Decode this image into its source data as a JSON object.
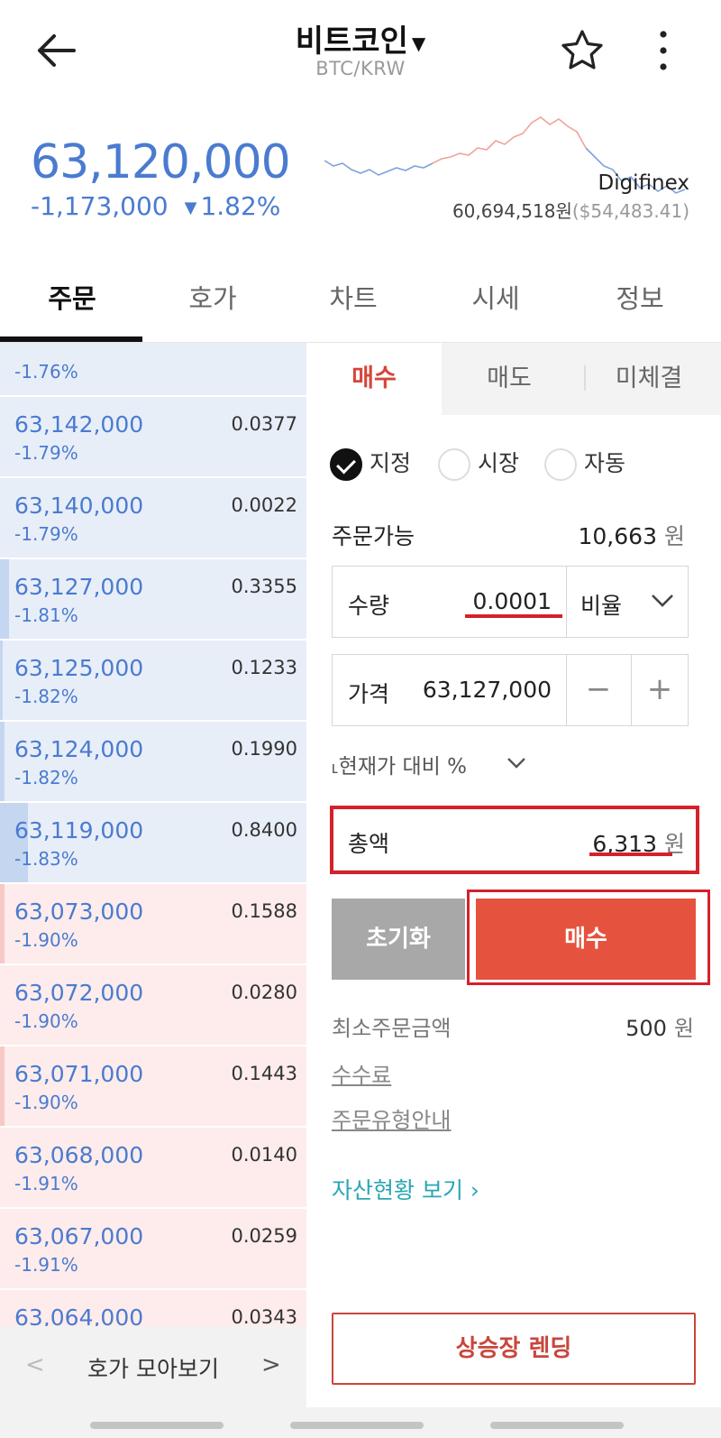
{
  "header": {
    "title": "비트코인",
    "pair": "BTC/KRW"
  },
  "price": {
    "current": "63,120,000",
    "change": "-1,173,000",
    "change_pct": "1.82%",
    "exchange": "Digifinex",
    "ref_krw": "60,694,518원",
    "ref_usd": "($54,483.41)",
    "trend_color": "#4a7bd0"
  },
  "tabs": [
    "주문",
    "호가",
    "차트",
    "시세",
    "정보"
  ],
  "order_book": {
    "rows": [
      {
        "price": "",
        "pct": "-1.76%",
        "qty": "",
        "side": "ask",
        "fill": 0.0
      },
      {
        "price": "63,142,000",
        "pct": "-1.79%",
        "qty": "0.0377",
        "side": "ask",
        "fill": 0.0
      },
      {
        "price": "63,140,000",
        "pct": "-1.79%",
        "qty": "0.0022",
        "side": "ask",
        "fill": 0.0
      },
      {
        "price": "63,127,000",
        "pct": "-1.81%",
        "qty": "0.3355",
        "side": "ask",
        "fill": 0.03
      },
      {
        "price": "63,125,000",
        "pct": "-1.82%",
        "qty": "0.1233",
        "side": "ask",
        "fill": 0.01
      },
      {
        "price": "63,124,000",
        "pct": "-1.82%",
        "qty": "0.1990",
        "side": "ask",
        "fill": 0.015
      },
      {
        "price": "63,119,000",
        "pct": "-1.83%",
        "qty": "0.8400",
        "side": "ask",
        "fill": 0.09
      },
      {
        "price": "63,073,000",
        "pct": "-1.90%",
        "qty": "0.1588",
        "side": "bid",
        "fill": 0.015
      },
      {
        "price": "63,072,000",
        "pct": "-1.90%",
        "qty": "0.0280",
        "side": "bid",
        "fill": 0.0
      },
      {
        "price": "63,071,000",
        "pct": "-1.90%",
        "qty": "0.1443",
        "side": "bid",
        "fill": 0.015
      },
      {
        "price": "63,068,000",
        "pct": "-1.91%",
        "qty": "0.0140",
        "side": "bid",
        "fill": 0.0
      },
      {
        "price": "63,067,000",
        "pct": "-1.91%",
        "qty": "0.0259",
        "side": "bid",
        "fill": 0.0
      },
      {
        "price": "63,064,000",
        "pct": "",
        "qty": "0.0343",
        "side": "bid",
        "fill": 0.0
      }
    ],
    "footer_label": "호가 모아보기"
  },
  "order_panel": {
    "tabs": [
      "매수",
      "매도",
      "미체결"
    ],
    "order_types": [
      "지정",
      "시장",
      "자동"
    ],
    "selected_type": "지정",
    "available_label": "주문가능",
    "available_value": "10,663",
    "currency": "원",
    "qty_label": "수량",
    "qty_value": "0.0001",
    "ratio_label": "비율",
    "price_label": "가격",
    "price_value": "63,127,000",
    "compare_label": "현재가 대비 %",
    "total_label": "총액",
    "total_value": "6,313",
    "reset_label": "초기화",
    "buy_label": "매수",
    "min_order_label": "최소주문금액",
    "min_order_value": "500",
    "fee_link": "수수료",
    "guide_link": "주문유형안내",
    "asset_link": "자산현황 보기",
    "lending_label": "상승장 렌딩",
    "buy_color": "#e5533f",
    "highlight_color": "#d4212c"
  }
}
